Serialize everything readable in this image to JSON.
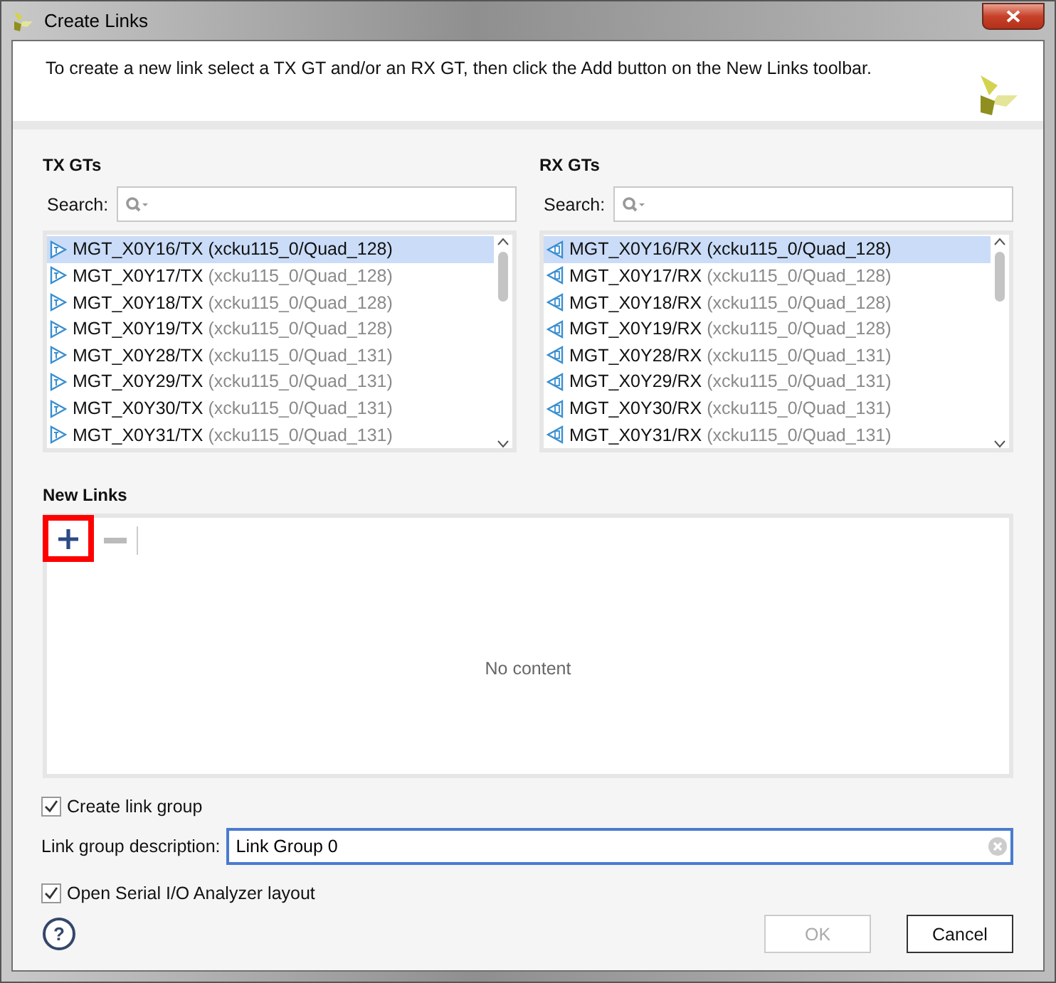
{
  "window": {
    "title": "Create Links"
  },
  "header": {
    "message": "To create a new link select a TX GT and/or an RX GT, then click the Add button on the New Links toolbar."
  },
  "panels": [
    {
      "title": "TX GTs",
      "kind": "tx",
      "search_label": "Search:",
      "items": [
        {
          "name": "MGT_X0Y16/TX",
          "location": "(xcku115_0/Quad_128)",
          "selected": true
        },
        {
          "name": "MGT_X0Y17/TX",
          "location": "(xcku115_0/Quad_128)",
          "selected": false
        },
        {
          "name": "MGT_X0Y18/TX",
          "location": "(xcku115_0/Quad_128)",
          "selected": false
        },
        {
          "name": "MGT_X0Y19/TX",
          "location": "(xcku115_0/Quad_128)",
          "selected": false
        },
        {
          "name": "MGT_X0Y28/TX",
          "location": "(xcku115_0/Quad_131)",
          "selected": false
        },
        {
          "name": "MGT_X0Y29/TX",
          "location": "(xcku115_0/Quad_131)",
          "selected": false
        },
        {
          "name": "MGT_X0Y30/TX",
          "location": "(xcku115_0/Quad_131)",
          "selected": false
        },
        {
          "name": "MGT_X0Y31/TX",
          "location": "(xcku115_0/Quad_131)",
          "selected": false
        }
      ]
    },
    {
      "title": "RX GTs",
      "kind": "rx",
      "search_label": "Search:",
      "items": [
        {
          "name": "MGT_X0Y16/RX",
          "location": "(xcku115_0/Quad_128)",
          "selected": true
        },
        {
          "name": "MGT_X0Y17/RX",
          "location": "(xcku115_0/Quad_128)",
          "selected": false
        },
        {
          "name": "MGT_X0Y18/RX",
          "location": "(xcku115_0/Quad_128)",
          "selected": false
        },
        {
          "name": "MGT_X0Y19/RX",
          "location": "(xcku115_0/Quad_128)",
          "selected": false
        },
        {
          "name": "MGT_X0Y28/RX",
          "location": "(xcku115_0/Quad_131)",
          "selected": false
        },
        {
          "name": "MGT_X0Y29/RX",
          "location": "(xcku115_0/Quad_131)",
          "selected": false
        },
        {
          "name": "MGT_X0Y30/RX",
          "location": "(xcku115_0/Quad_131)",
          "selected": false
        },
        {
          "name": "MGT_X0Y31/RX",
          "location": "(xcku115_0/Quad_131)",
          "selected": false
        }
      ]
    }
  ],
  "new_links": {
    "title": "New Links",
    "add_highlighted": true,
    "remove_disabled": true,
    "empty_text": "No content"
  },
  "create_link_group": {
    "label": "Create link group",
    "checked": true
  },
  "link_group_description": {
    "label": "Link group description:",
    "value": "Link Group 0"
  },
  "open_analyzer": {
    "label": "Open Serial I/O Analyzer layout",
    "checked": true
  },
  "help": {
    "glyph": "?"
  },
  "buttons": [
    {
      "label": "OK",
      "disabled": true
    },
    {
      "label": "Cancel",
      "disabled": false
    }
  ]
}
